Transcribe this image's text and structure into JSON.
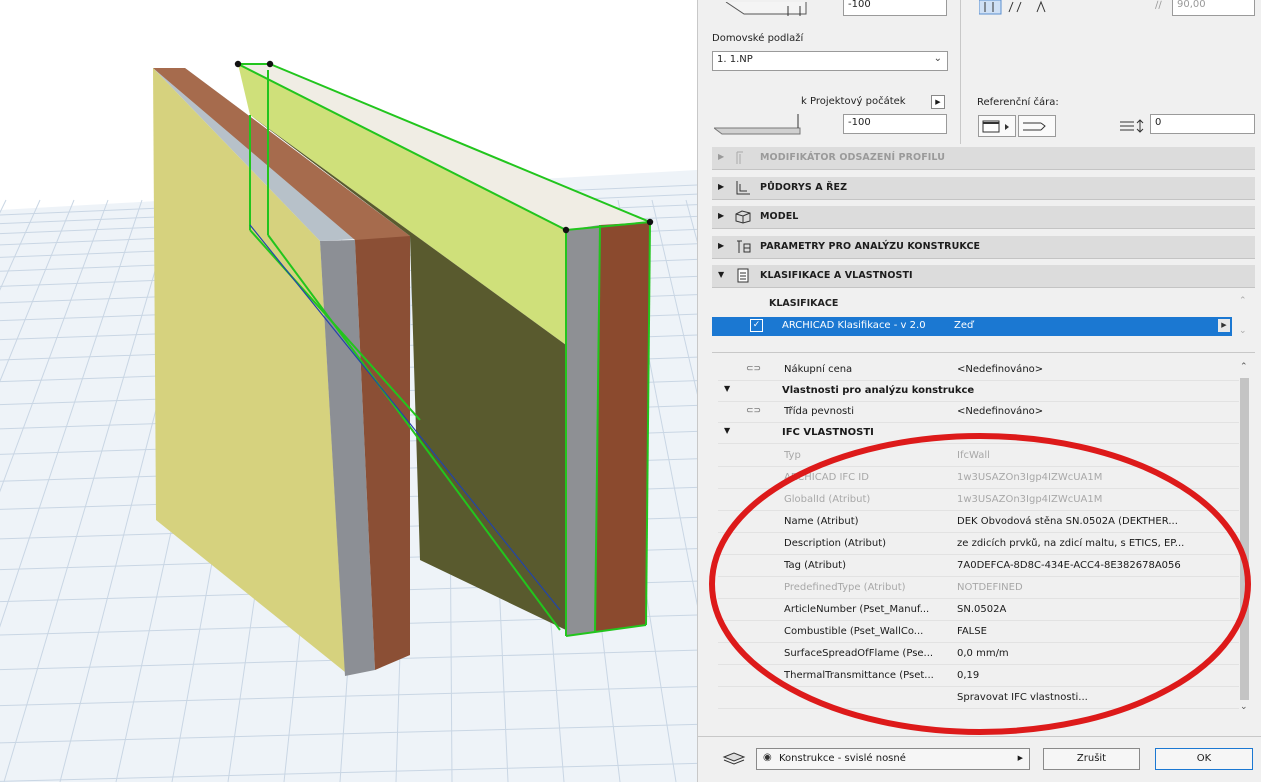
{
  "colors": {
    "accent": "#1b78d2",
    "highlight_text": "#ffffff",
    "annotation": "#dd1a1a",
    "selection": "#22c51d"
  },
  "viewport": {
    "description_icons": [
      "wall-3d-icon"
    ]
  },
  "panel": {
    "top_value": "-100",
    "top_right_value": "90,00",
    "home_floor_label": "Domovské podlaží",
    "home_floor_value": "1. 1.NP",
    "project_origin_label": "k Projektový počátek",
    "project_origin_value": "-100",
    "reference_line_label": "Referenční čára:",
    "reference_offset_value": "0",
    "sections": [
      {
        "label": "MODIFIKÁTOR ODSAZENÍ PROFILU",
        "icon": "profile-modifier-icon",
        "disabled": true
      },
      {
        "label": "PŮDORYS A ŘEZ",
        "icon": "floor-plan-icon"
      },
      {
        "label": "MODEL",
        "icon": "model-icon"
      },
      {
        "label": "PARAMETRY PRO ANALÝZU KONSTRUKCE",
        "icon": "structural-analysis-icon"
      },
      {
        "label": "KLASIFIKACE A VLASTNOSTI",
        "icon": "classification-icon",
        "expanded": true
      }
    ],
    "classification_header": "KLASIFIKACE",
    "classification_system": "ARCHICAD Klasifikace - v 2.0",
    "classification_value": "Zeď",
    "properties": [
      {
        "name": "Nákupní cena",
        "value": "<Nedefinováno>",
        "icon": "link-icon"
      },
      {
        "name": "Vlastnosti pro analýzu konstrukce",
        "group": true
      },
      {
        "name": "Třída pevnosti",
        "value": "<Nedefinováno>",
        "icon": "link-icon"
      },
      {
        "name": "IFC VLASTNOSTI",
        "group": true
      },
      {
        "name": "Typ",
        "value": "IfcWall",
        "dim": true
      },
      {
        "name": "ARCHICAD IFC ID",
        "value": "1w3USAZOn3Igp4IZWcUA1M",
        "dim": true
      },
      {
        "name": "GlobalId (Atribut)",
        "value": "1w3USAZOn3Igp4IZWcUA1M",
        "dim": true
      },
      {
        "name": "Name (Atribut)",
        "value": "DEK Obvodová stěna SN.0502A (DEKTHER..."
      },
      {
        "name": "Description (Atribut)",
        "value": "ze zdicích prvků, na zdicí maltu, s ETICS, EP..."
      },
      {
        "name": "Tag (Atribut)",
        "value": "7A0DEFCA-8D8C-434E-ACC4-8E382678A056"
      },
      {
        "name": "PredefinedType (Atribut)",
        "value": "NOTDEFINED",
        "dim": true
      },
      {
        "name": "ArticleNumber (Pset_Manuf...",
        "value": "SN.0502A"
      },
      {
        "name": "Combustible (Pset_WallCo...",
        "value": "FALSE"
      },
      {
        "name": "SurfaceSpreadOfFlame (Pse...",
        "value": "0,0 mm/m"
      },
      {
        "name": "ThermalTransmittance (Pset...",
        "value": "0,19"
      },
      {
        "name": "",
        "value": "Spravovat IFC vlastnosti..."
      }
    ],
    "layer_value": "Konstrukce - svislé nosné",
    "cancel_label": "Zrušit",
    "ok_label": "OK"
  }
}
